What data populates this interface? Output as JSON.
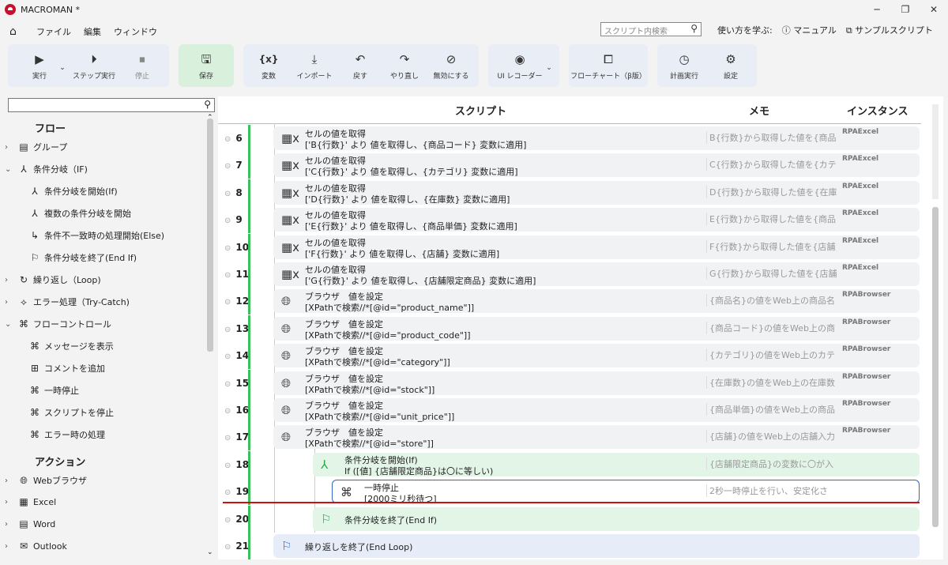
{
  "app": {
    "title": "MACROMAN *"
  },
  "menu": {
    "file": "ファイル",
    "edit": "編集",
    "window": "ウィンドウ",
    "search_placeholder": "スクリプト内検索",
    "learn": "使い方を学ぶ:",
    "manual": "マニュアル",
    "sample": "サンプルスクリプト"
  },
  "toolbar": {
    "run": "実行",
    "step": "ステップ実行",
    "stop": "停止",
    "save": "保存",
    "variables": "変数",
    "import": "インポート",
    "undo": "戻す",
    "redo": "やり直し",
    "disable": "無効にする",
    "ui_recorder": "UI レコーダー",
    "flowchart": "フローチャート（β版）",
    "schedule": "計画実行",
    "settings": "設定"
  },
  "sidebar": {
    "flow_header": "フロー",
    "action_header": "アクション",
    "items": [
      "グループ",
      "条件分岐（IF)",
      "条件分岐を開始(If)",
      "複数の条件分岐を開始",
      "条件不一致時の処理開始(Else)",
      "条件分岐を終了(End If)",
      "繰り返し（Loop)",
      "エラー処理（Try-Catch)",
      "フローコントロール",
      "メッセージを表示",
      "コメントを追加",
      "一時停止",
      "スクリプトを停止",
      "エラー時の処理",
      "Webブラウザ",
      "Excel",
      "Word",
      "Outlook"
    ]
  },
  "columns": {
    "script": "スクリプト",
    "memo": "メモ",
    "instance": "インスタンス"
  },
  "rows": [
    {
      "n": "6",
      "t1": "セルの値を取得",
      "t2": "['B{行数}' より 値を取得し、{商品コード} 変数に適用]",
      "memo": "B{行数}から取得した値を{商品",
      "inst": "RPAExcel"
    },
    {
      "n": "7",
      "t1": "セルの値を取得",
      "t2": "['C{行数}' より 値を取得し、{カテゴリ} 変数に適用]",
      "memo": "C{行数}から取得した値を{カテ",
      "inst": "RPAExcel"
    },
    {
      "n": "8",
      "t1": "セルの値を取得",
      "t2": "['D{行数}' より 値を取得し、{在庫数} 変数に適用]",
      "memo": "D{行数}から取得した値を{在庫",
      "inst": "RPAExcel"
    },
    {
      "n": "9",
      "t1": "セルの値を取得",
      "t2": "['E{行数}' より 値を取得し、{商品単価} 変数に適用]",
      "memo": "E{行数}から取得した値を{商品",
      "inst": "RPAExcel"
    },
    {
      "n": "10",
      "t1": "セルの値を取得",
      "t2": "['F{行数}' より 値を取得し、{店舗} 変数に適用]",
      "memo": "F{行数}から取得した値を{店舗}",
      "inst": "RPAExcel"
    },
    {
      "n": "11",
      "t1": "セルの値を取得",
      "t2": "['G{行数}' より 値を取得し、{店舗限定商品} 変数に適用]",
      "memo": "G{行数}から取得した値を{店舗",
      "inst": "RPAExcel"
    },
    {
      "n": "12",
      "t1": "ブラウザ　値を設定",
      "t2": "[XPathで検索//*[@id=\"product_name\"]]",
      "memo": "{商品名}の値をWeb上の商品名",
      "inst": "RPABrowser"
    },
    {
      "n": "13",
      "t1": "ブラウザ　値を設定",
      "t2": "[XPathで検索//*[@id=\"product_code\"]]",
      "memo": "{商品コード}の値をWeb上の商",
      "inst": "RPABrowser"
    },
    {
      "n": "14",
      "t1": "ブラウザ　値を設定",
      "t2": "[XPathで検索//*[@id=\"category\"]]",
      "memo": "{カテゴリ}の値をWeb上のカテ",
      "inst": "RPABrowser"
    },
    {
      "n": "15",
      "t1": "ブラウザ　値を設定",
      "t2": "[XPathで検索//*[@id=\"stock\"]]",
      "memo": "{在庫数}の値をWeb上の在庫数",
      "inst": "RPABrowser"
    },
    {
      "n": "16",
      "t1": "ブラウザ　値を設定",
      "t2": "[XPathで検索//*[@id=\"unit_price\"]]",
      "memo": "{商品単価}の値をWeb上の商品",
      "inst": "RPABrowser"
    },
    {
      "n": "17",
      "t1": "ブラウザ　値を設定",
      "t2": "[XPathで検索//*[@id=\"store\"]]",
      "memo": "{店舗}の値をWeb上の店舗入力",
      "inst": "RPABrowser"
    },
    {
      "n": "18",
      "t1": "条件分岐を開始(If)",
      "t2": "If ([値] {店舗限定商品}は〇に等しい)",
      "memo": "{店舗限定商品}の変数に〇が入",
      "inst": ""
    },
    {
      "n": "19",
      "t1": "一時停止",
      "t2": "[2000ミリ秒待つ]",
      "memo": "2秒一時停止を行い、安定化さ",
      "inst": ""
    },
    {
      "n": "20",
      "t1": "条件分岐を終了(End If)",
      "t2": "",
      "memo": "",
      "inst": ""
    },
    {
      "n": "21",
      "t1": "繰り返しを終了(End Loop)",
      "t2": "",
      "memo": "",
      "inst": ""
    }
  ]
}
